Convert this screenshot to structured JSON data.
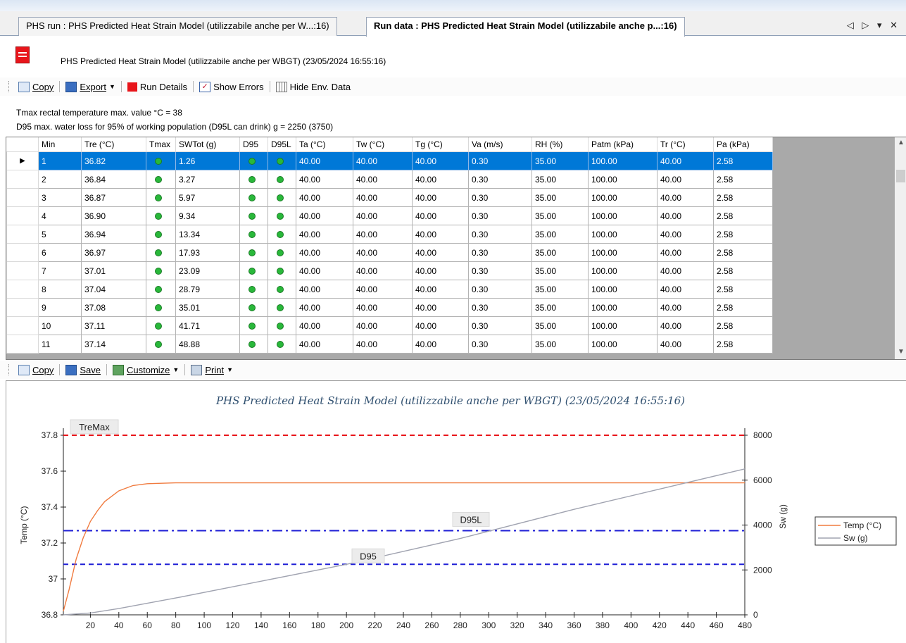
{
  "tabs": [
    {
      "label": "PHS run : PHS Predicted Heat Strain Model (utilizzabile anche per W...:16)",
      "active": false
    },
    {
      "label": "Run data : PHS Predicted Heat Strain Model (utilizzabile anche p...:16)",
      "active": true
    }
  ],
  "tab_controls": "◁ ▷ ▾ ✕",
  "report_title": "PHS Predicted Heat Strain Model (utilizzabile anche per WBGT) (23/05/2024 16:55:16)",
  "toolbar1": {
    "copy": "Copy",
    "export": "Export",
    "run_details": "Run Details",
    "show_errors": "Show Errors",
    "hide_env": "Hide Env. Data"
  },
  "info": {
    "tmax": "Tmax rectal temperature max. value °C = 38",
    "d95": "D95 max. water loss for 95% of working population (D95L can drink) g = 2250 (3750)"
  },
  "table": {
    "columns": [
      "Min",
      "Tre (°C)",
      "Tmax",
      "SWTot (g)",
      "D95",
      "D95L",
      "Ta (°C)",
      "Tw (°C)",
      "Tg (°C)",
      "Va (m/s)",
      "RH (%)",
      "Patm (kPa)",
      "Tr (°C)",
      "Pa (kPa)"
    ],
    "rows": [
      [
        "1",
        "36.82",
        "●",
        "1.26",
        "●",
        "●",
        "40.00",
        "40.00",
        "40.00",
        "0.30",
        "35.00",
        "100.00",
        "40.00",
        "2.58"
      ],
      [
        "2",
        "36.84",
        "●",
        "3.27",
        "●",
        "●",
        "40.00",
        "40.00",
        "40.00",
        "0.30",
        "35.00",
        "100.00",
        "40.00",
        "2.58"
      ],
      [
        "3",
        "36.87",
        "●",
        "5.97",
        "●",
        "●",
        "40.00",
        "40.00",
        "40.00",
        "0.30",
        "35.00",
        "100.00",
        "40.00",
        "2.58"
      ],
      [
        "4",
        "36.90",
        "●",
        "9.34",
        "●",
        "●",
        "40.00",
        "40.00",
        "40.00",
        "0.30",
        "35.00",
        "100.00",
        "40.00",
        "2.58"
      ],
      [
        "5",
        "36.94",
        "●",
        "13.34",
        "●",
        "●",
        "40.00",
        "40.00",
        "40.00",
        "0.30",
        "35.00",
        "100.00",
        "40.00",
        "2.58"
      ],
      [
        "6",
        "36.97",
        "●",
        "17.93",
        "●",
        "●",
        "40.00",
        "40.00",
        "40.00",
        "0.30",
        "35.00",
        "100.00",
        "40.00",
        "2.58"
      ],
      [
        "7",
        "37.01",
        "●",
        "23.09",
        "●",
        "●",
        "40.00",
        "40.00",
        "40.00",
        "0.30",
        "35.00",
        "100.00",
        "40.00",
        "2.58"
      ],
      [
        "8",
        "37.04",
        "●",
        "28.79",
        "●",
        "●",
        "40.00",
        "40.00",
        "40.00",
        "0.30",
        "35.00",
        "100.00",
        "40.00",
        "2.58"
      ],
      [
        "9",
        "37.08",
        "●",
        "35.01",
        "●",
        "●",
        "40.00",
        "40.00",
        "40.00",
        "0.30",
        "35.00",
        "100.00",
        "40.00",
        "2.58"
      ],
      [
        "10",
        "37.11",
        "●",
        "41.71",
        "●",
        "●",
        "40.00",
        "40.00",
        "40.00",
        "0.30",
        "35.00",
        "100.00",
        "40.00",
        "2.58"
      ],
      [
        "11",
        "37.14",
        "●",
        "48.88",
        "●",
        "●",
        "40.00",
        "40.00",
        "40.00",
        "0.30",
        "35.00",
        "100.00",
        "40.00",
        "2.58"
      ]
    ],
    "selected_row": 0
  },
  "toolbar2": {
    "copy": "Copy",
    "save": "Save",
    "customize": "Customize",
    "print": "Print"
  },
  "chart_data": {
    "type": "line",
    "title": "PHS Predicted Heat Strain Model (utilizzabile anche per WBGT) (23/05/2024 16:55:16)",
    "xlabel": "",
    "ylabel": "Temp (°C)",
    "y2label": "Sw (g)",
    "xlim": [
      1,
      480
    ],
    "ylim": [
      36.8,
      37.8
    ],
    "y2lim": [
      0,
      8000
    ],
    "xticks": [
      20,
      40,
      60,
      80,
      100,
      120,
      140,
      160,
      180,
      200,
      220,
      240,
      260,
      280,
      300,
      320,
      340,
      360,
      380,
      400,
      420,
      440,
      460,
      480
    ],
    "yticks": [
      "36.8",
      "37",
      "37.2",
      "37.4",
      "37.6",
      "37.8"
    ],
    "y2ticks": [
      "0",
      "2000",
      "4000",
      "6000",
      "8000"
    ],
    "series": [
      {
        "name": "Temp (°C)",
        "axis": "left",
        "color": "#f07b3f",
        "x": [
          1,
          5,
          10,
          15,
          20,
          25,
          30,
          40,
          50,
          60,
          80,
          120,
          200,
          300,
          400,
          480
        ],
        "y": [
          36.82,
          36.94,
          37.11,
          37.23,
          37.32,
          37.38,
          37.43,
          37.49,
          37.52,
          37.53,
          37.535,
          37.535,
          37.535,
          37.535,
          37.535,
          37.535
        ]
      },
      {
        "name": "Sw (g)",
        "axis": "right",
        "color": "#a0a3b0",
        "x": [
          1,
          20,
          40,
          80,
          120,
          200,
          280,
          360,
          480
        ],
        "y": [
          0,
          80,
          280,
          750,
          1250,
          2250,
          3400,
          4700,
          6500
        ]
      }
    ],
    "reference_lines": [
      {
        "label": "TreMax",
        "axis": "left",
        "value": 37.8,
        "color": "#e8151b",
        "style": "dash"
      },
      {
        "label": "D95L",
        "axis": "right",
        "value": 3750,
        "color": "#1f1fd6",
        "style": "dashdot"
      },
      {
        "label": "D95",
        "axis": "right",
        "value": 2250,
        "color": "#1f1fd6",
        "style": "dash"
      }
    ],
    "legend": "right",
    "grid": false
  }
}
